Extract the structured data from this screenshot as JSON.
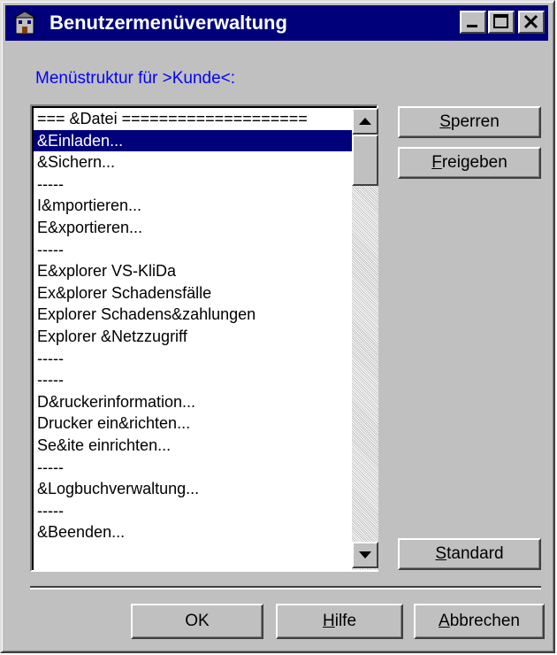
{
  "window": {
    "title": "Benutzermenüverwaltung",
    "icon": "app-building-icon",
    "controls": [
      "minimize-icon",
      "maximize-icon",
      "close-icon"
    ]
  },
  "group_label": "Menüstruktur für >Kunde<:",
  "list": {
    "items": [
      "=== &Datei ====================",
      "&Einladen...",
      "&Sichern...",
      "-----",
      "I&mportieren...",
      "E&xportieren...",
      "-----",
      "E&xplorer VS-KliDa",
      "Ex&plorer Schadensfälle",
      "Explorer Schadens&zahlungen",
      "Explorer &Netzzugriff",
      "-----",
      "-----",
      "D&ruckerinformation...",
      "Drucker ein&richten...",
      "Se&ite einrichten...",
      "-----",
      "&Logbuchverwaltung...",
      "-----",
      "&Beenden..."
    ],
    "selected_index": 1
  },
  "buttons": {
    "sperren": {
      "mnemonic": "S",
      "rest": "perren"
    },
    "freigeben": {
      "mnemonic": "F",
      "rest": "reigeben"
    },
    "standard": {
      "mnemonic": "S",
      "rest": "tandard"
    },
    "ok": "OK",
    "hilfe": {
      "mnemonic": "H",
      "rest": "ilfe"
    },
    "abbrechen": {
      "mnemonic": "A",
      "rest": "bbrechen"
    }
  }
}
